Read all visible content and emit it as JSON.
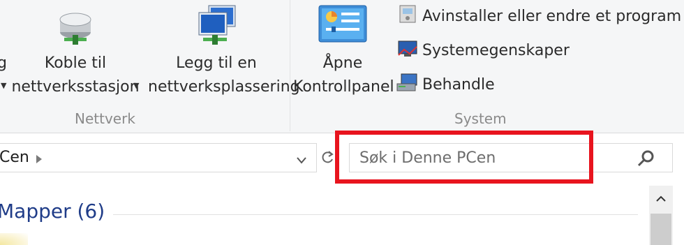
{
  "ribbon": {
    "network_group": {
      "label": "Nettverk",
      "partial_button_text": "g",
      "map_drive": {
        "line1": "Koble til",
        "line2": "nettverksstasjon"
      },
      "add_location": {
        "line1": "Legg til en",
        "line2": "nettverksplassering"
      }
    },
    "system_group": {
      "label": "System",
      "control_panel": {
        "line1": "Åpne",
        "line2": "Kontrollpanel"
      },
      "uninstall": "Avinstaller eller endre et program",
      "system_properties": "Systemegenskaper",
      "manage": "Behandle"
    }
  },
  "address_bar": {
    "path_fragment": "Cen"
  },
  "search": {
    "placeholder": "Søk i Denne PCen"
  },
  "content": {
    "section_title": "Mapper (6)"
  },
  "colors": {
    "highlight": "#e8141e",
    "section_title": "#1f3c88"
  }
}
